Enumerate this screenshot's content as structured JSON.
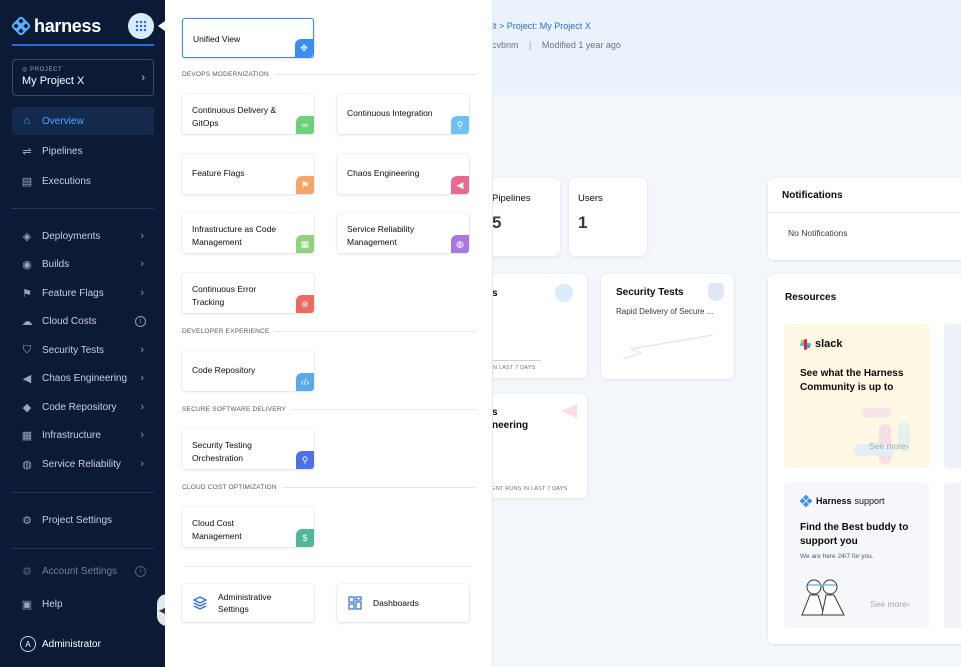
{
  "brand": {
    "name": "harness"
  },
  "project": {
    "kicker": "PROJECT",
    "name": "My Project X"
  },
  "sidebar": {
    "items": [
      {
        "label": "Overview"
      },
      {
        "label": "Pipelines"
      },
      {
        "label": "Executions"
      },
      {
        "label": "Deployments"
      },
      {
        "label": "Builds"
      },
      {
        "label": "Feature Flags"
      },
      {
        "label": "Cloud Costs"
      },
      {
        "label": "Security Tests"
      },
      {
        "label": "Chaos Engineering"
      },
      {
        "label": "Code Repository"
      },
      {
        "label": "Infrastructure"
      },
      {
        "label": "Service Reliability"
      }
    ],
    "project_settings": "Project Settings",
    "account_settings": "Account Settings",
    "help": "Help",
    "user": "Administrator",
    "user_initial": "A"
  },
  "overlay": {
    "unified_view": "Unified View",
    "sections": {
      "devops": "DEVOPS MODERNIZATION",
      "devex": "DEVELOPER EXPERIENCE",
      "secure": "SECURE SOFTWARE DELIVERY",
      "cloud": "CLOUD COST OPTIMIZATION"
    },
    "tiles": {
      "cd": "Continuous Delivery & GitOps",
      "ci": "Continuous Integration",
      "ff": "Feature Flags",
      "chaos": "Chaos Engineering",
      "iac": "Infrastructure as Code Management",
      "srm": "Service Reliability Management",
      "cet": "Continuous Error Tracking",
      "code": "Code Repository",
      "sto": "Security Testing Orchestration",
      "ccm": "Cloud Cost Management"
    },
    "admin_settings": "Administrative Settings",
    "dashboards": "Dashboards"
  },
  "main": {
    "breadcrumb": "lt  >  Project: My Project X",
    "meta_id": "cvbnm",
    "meta_sep": "|",
    "meta_modified": "Modified 1 year ago",
    "pipelines_label": "Pipelines",
    "pipelines_count": "5",
    "users_label": "Users",
    "users_count": "1",
    "notifications_title": "Notifications",
    "notifications_empty": "No Notifications",
    "card_s_fragment": "s",
    "card_s_footer": "N LAST 7 DAYS",
    "security_tests_title": "Security Tests",
    "security_tests_desc": "Rapid Delivery of Secure ...",
    "chaos_fragment_1": "s",
    "chaos_fragment_2": "neering",
    "chaos_footer": "ENT RUNS IN LAST 7 DAYS",
    "resources_title": "Resources",
    "slack_brand": "slack",
    "slack_text": "See what the Harness Community is up to",
    "see_more": "See more",
    "support_brand": "Harness",
    "support_brand_suffix": "support",
    "support_title": "Find the Best buddy to support you",
    "support_sub": "We are here 24/7 for you."
  },
  "colors": {
    "sidebar_bg": "#0b1b36",
    "accent": "#2b6fd6",
    "active_text": "#4fa4ff"
  }
}
